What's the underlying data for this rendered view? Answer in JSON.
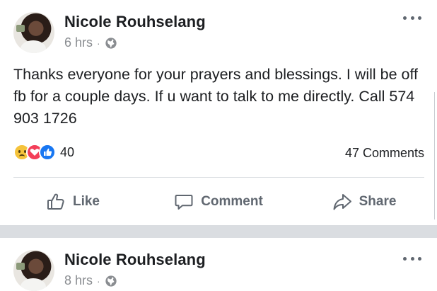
{
  "posts": [
    {
      "author": "Nicole Rouhselang",
      "time": "6 hrs",
      "separator": "·",
      "text": "Thanks everyone for your prayers and blessings. I will be off fb for a couple days. If u want to talk to me directly. Call 574 903 1726",
      "reactions": {
        "icons": [
          "sad-icon",
          "love-icon",
          "like-icon"
        ],
        "count": "40"
      },
      "comments": "47 Comments",
      "actions": {
        "like": "Like",
        "comment": "Comment",
        "share": "Share"
      }
    },
    {
      "author": "Nicole Rouhselang",
      "time": "8 hrs",
      "separator": "·"
    }
  ],
  "colors": {
    "text": "#1c1e21",
    "meta": "#8a8d91",
    "action": "#606770",
    "like_blue": "#1877f2",
    "love_red": "#f33e58",
    "sad_yellow": "#f5c33b",
    "divider": "#dadde1"
  }
}
